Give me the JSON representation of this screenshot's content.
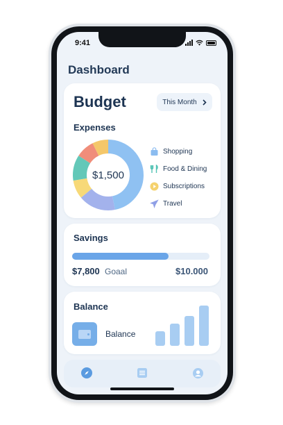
{
  "status": {
    "time": "9:41"
  },
  "header": {
    "title": "Dashboard"
  },
  "budget": {
    "title": "Budget",
    "period_button": "This Month",
    "expenses_label": "Expenses",
    "total": "$1,500",
    "legend": [
      {
        "label": "Shopping",
        "icon": "shopping-bag-icon",
        "color": "#8bbcf0"
      },
      {
        "label": "Food & Dining",
        "icon": "fork-knife-icon",
        "color": "#52c3b4"
      },
      {
        "label": "Subscriptions",
        "icon": "play-circle-icon",
        "color": "#f5d26e"
      },
      {
        "label": "Travel",
        "icon": "airplane-icon",
        "color": "#8f9fe6"
      }
    ]
  },
  "chart_data": {
    "type": "pie",
    "categories": [
      "Blue",
      "Lavender",
      "Yellow",
      "Teal",
      "Coral",
      "Gold"
    ],
    "values": [
      44,
      16,
      8,
      11,
      8,
      7
    ],
    "colors": [
      "#8fc1f2",
      "#a3b2ec",
      "#f7d978",
      "#63c8b8",
      "#f08d7a",
      "#f4c76a"
    ],
    "center_label": "$1,500"
  },
  "savings": {
    "title": "Savings",
    "amount": "$7,800",
    "goal_label": "Goaal",
    "target": "$10.000",
    "progress": 0.7
  },
  "balance": {
    "title": "Balance",
    "label": "Balance",
    "bars": [
      0.33,
      0.5,
      0.67,
      0.9
    ]
  },
  "colors": {
    "accent": "#6aa5e8",
    "background": "#eef3f9",
    "text": "#1d3452"
  },
  "tabbar": {
    "icons": [
      "compass-icon",
      "list-icon",
      "profile-icon"
    ]
  }
}
